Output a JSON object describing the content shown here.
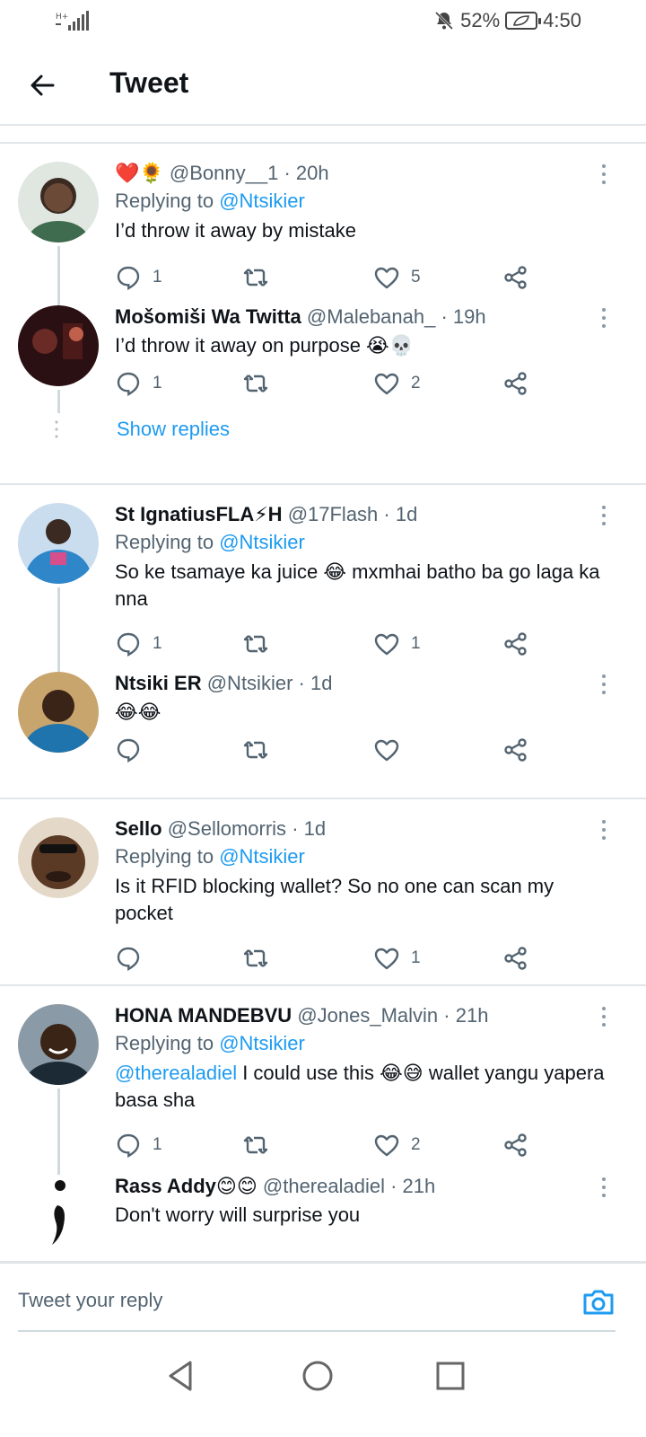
{
  "status_bar": {
    "network": "H+",
    "battery_percent": "52%",
    "time": "4:50"
  },
  "header": {
    "title": "Tweet"
  },
  "tweets": [
    {
      "prefix_emoji": "❤️🌻",
      "name": "",
      "handle": "@Bonny__1",
      "time": "· 20h",
      "replying_prefix": "Replying to",
      "replying_to": "@Ntsikier",
      "text": "I’d throw it away by mistake",
      "replies": "1",
      "retweets": "",
      "likes": "5"
    },
    {
      "name": "Mošomiši Wa Twitta",
      "handle": "@Malebanah_",
      "time": "· 19h",
      "text": "I’d throw it away on purpose 😭💀",
      "replies": "1",
      "retweets": "",
      "likes": "2"
    },
    {
      "name": "St IgnatiusFLA⚡H",
      "handle": "@17Flash",
      "time": "· 1d",
      "replying_prefix": "Replying to",
      "replying_to": "@Ntsikier",
      "text": "So ke tsamaye ka juice 😂 mxmhai batho ba go laga ka nna",
      "replies": "1",
      "retweets": "",
      "likes": "1"
    },
    {
      "name": "Ntsiki ER",
      "handle": "@Ntsikier",
      "time": "· 1d",
      "text": "😂😂",
      "replies": "",
      "retweets": "",
      "likes": ""
    },
    {
      "name": "Sello",
      "handle": "@Sellomorris",
      "time": "· 1d",
      "replying_prefix": "Replying to",
      "replying_to": "@Ntsikier",
      "text": "Is it RFID blocking wallet? So no one can scan my pocket",
      "replies": "",
      "retweets": "",
      "likes": "1"
    },
    {
      "name": "HONA MANDEBVU",
      "handle": "@Jones_Malvin",
      "time": "· 21h",
      "replying_prefix": "Replying to",
      "replying_to": "@Ntsikier",
      "text_mention": "@therealadiel",
      "text": " I could use this 😂😅 wallet yangu yapera basa sha",
      "replies": "1",
      "retweets": "",
      "likes": "2"
    },
    {
      "name": "Rass Addy😊😊",
      "handle": "@therealadiel",
      "time": "· 21h",
      "text": "Don't worry will surprise you"
    }
  ],
  "show_replies_label": "Show replies",
  "composer": {
    "placeholder": "Tweet your reply"
  },
  "icons": {
    "accent": "#1d9bf0",
    "muted": "#536471"
  }
}
